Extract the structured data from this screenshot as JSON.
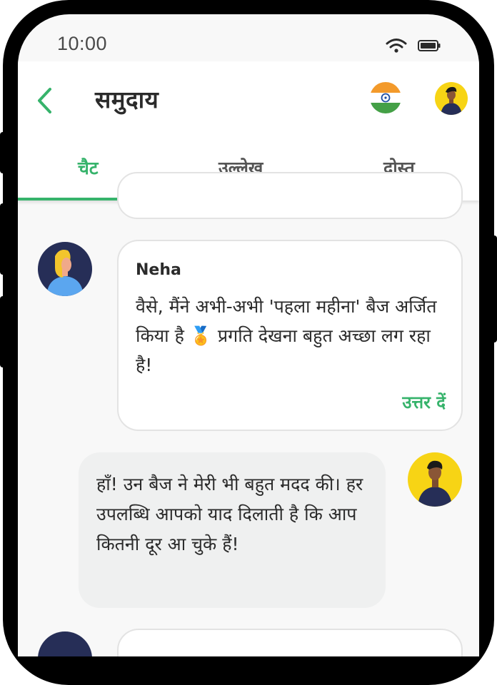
{
  "status_bar": {
    "time": "10:00",
    "wifi_icon": "wifi-icon",
    "battery_icon": "battery-icon"
  },
  "header": {
    "back_icon": "chevron-left-icon",
    "title": "समुदाय",
    "flag_icon": "india-flag-icon",
    "avatar_icon": "user-avatar-icon"
  },
  "tabs": [
    {
      "label": "चैट",
      "active": true
    },
    {
      "label": "उल्लेख",
      "active": false
    },
    {
      "label": "दोस्त",
      "active": false
    }
  ],
  "messages": [
    {
      "sender": "Neha",
      "text": "वैसे, मैंने अभी-अभी 'पहला महीना' बैज अर्जित किया है 🏅 प्रगति देखना बहुत अच्छा लग रहा है!",
      "reply_label": "उत्तर दें"
    },
    {
      "sender": "me",
      "text": "हाँ! उन बैज ने मेरी भी बहुत मदद की। हर उपलब्धि आपको याद दिलाती है कि आप कितनी दूर आ चुके हैं!"
    }
  ],
  "colors": {
    "accent": "#36b36b",
    "bubble_outline": "#e3e3e3",
    "my_bubble": "#eff0f0",
    "avatar_yellow": "#f7d415",
    "avatar_navy": "#262e57"
  }
}
